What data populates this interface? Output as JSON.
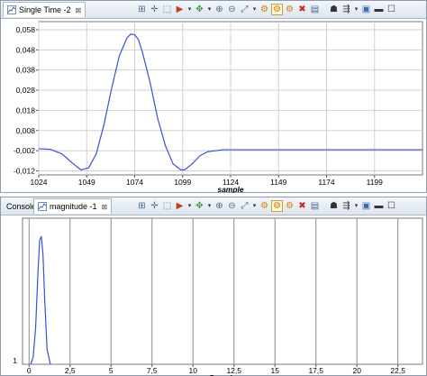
{
  "top_panel": {
    "tab_title": "Single Time -2",
    "tab_close": "⊠",
    "icons": [
      "axis-select-icon",
      "crosshair-icon",
      "cursor-icon",
      "marker-icon",
      "move-icon",
      "zoom-in-icon",
      "zoom-out-icon",
      "autoscale-icon",
      "mode-1-icon",
      "mode-2-icon",
      "mode-3-icon",
      "delete-icon",
      "table-icon",
      "pin-icon",
      "settings-icon",
      "save-icon",
      "minimize-icon",
      "maximize-icon"
    ],
    "chart_data": {
      "type": "line",
      "xlabel": "sample",
      "ylabel": "",
      "xlim": [
        1024,
        1224
      ],
      "ylim": [
        -0.014,
        0.062
      ],
      "x_ticks": [
        "1024",
        "1049",
        "1074",
        "1099",
        "1124",
        "1149",
        "1174",
        "1199"
      ],
      "y_ticks": [
        "0,058",
        "0,048",
        "0,038",
        "0,028",
        "0,018",
        "0,008",
        "-0,002",
        "-0,012"
      ],
      "series": [
        {
          "color": "#3a4fd8",
          "x": [
            1024,
            1030,
            1036,
            1042,
            1046,
            1050,
            1054,
            1058,
            1062,
            1066,
            1070,
            1072,
            1074,
            1076,
            1078,
            1082,
            1086,
            1090,
            1094,
            1098,
            1100,
            1104,
            1108,
            1112,
            1116,
            1120,
            1124,
            1224
          ],
          "y": [
            -0.001,
            -0.0013,
            -0.0035,
            -0.0085,
            -0.0115,
            -0.0105,
            -0.0035,
            0.011,
            0.029,
            0.045,
            0.054,
            0.0558,
            0.0555,
            0.053,
            0.047,
            0.032,
            0.014,
            0.0005,
            -0.0085,
            -0.0115,
            -0.0115,
            -0.0085,
            -0.0045,
            -0.0025,
            -0.002,
            -0.0015,
            -0.0015,
            -0.0015
          ]
        }
      ]
    }
  },
  "bottom_panel": {
    "console_tab": "Console",
    "tab_title": "magnitude -1",
    "tab_close": "⊠",
    "chart_data": {
      "type": "line",
      "xlabel": "Sample",
      "ylabel": "",
      "xlim": [
        -0.4,
        24
      ],
      "ylim": [
        0,
        40
      ],
      "x_ticks": [
        "0",
        "2,5",
        "5",
        "7,5",
        "10",
        "12,5",
        "15",
        "17,5",
        "20",
        "22,5"
      ],
      "y_ticks": [
        "1"
      ],
      "series": [
        {
          "color": "#3a4fd8",
          "x": [
            0.1,
            0.25,
            0.4,
            0.55,
            0.65,
            0.75,
            0.85,
            0.95,
            1.1,
            1.3
          ],
          "y": [
            0,
            2,
            10,
            26,
            34,
            35,
            30,
            18,
            4,
            0
          ]
        }
      ]
    }
  }
}
